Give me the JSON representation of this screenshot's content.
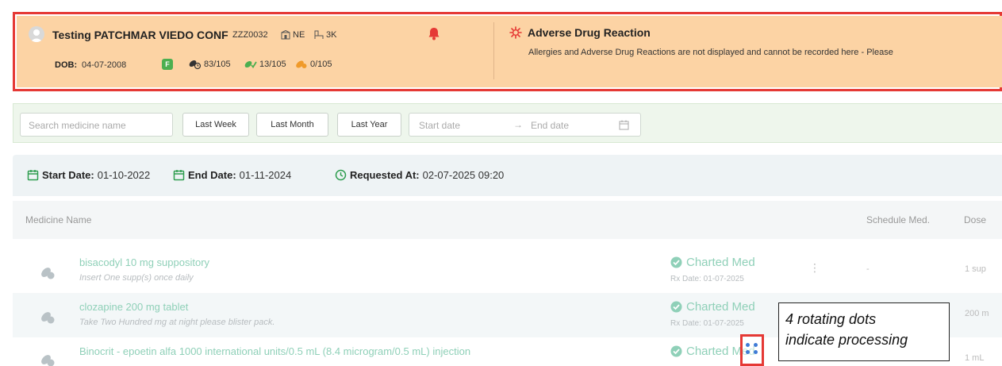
{
  "patient": {
    "name": "Testing PATCHMAR VIEDO CONF",
    "id": "ZZZ0032",
    "ward": "NE",
    "bed": "3K",
    "dob_label": "DOB:",
    "dob": "04-07-2008",
    "gender": "F",
    "stats": [
      "83/105",
      "13/105",
      "0/105"
    ]
  },
  "adr": {
    "title": "Adverse Drug Reaction",
    "text": "Allergies and Adverse Drug Reactions are not displayed and cannot be recorded here - Please"
  },
  "filters": {
    "search_placeholder": "Search medicine name",
    "buttons": [
      "Last Week",
      "Last Month",
      "Last Year"
    ],
    "start_placeholder": "Start date",
    "arrow": "→",
    "end_placeholder": "End date"
  },
  "info": {
    "start_label": "Start Date:",
    "start_value": "01-10-2022",
    "end_label": "End Date:",
    "end_value": "01-11-2024",
    "requested_label": "Requested At:",
    "requested_value": "02-07-2025 09:20"
  },
  "table": {
    "columns": [
      "Medicine Name",
      "Schedule Med.",
      "Dose"
    ],
    "rows": [
      {
        "name": "bisacodyl 10 mg suppository",
        "instruction": "Insert One supp(s) once daily",
        "status": "Charted Med",
        "rx_date": "Rx Date: 01-07-2025",
        "schedule": "-",
        "dose": "1 sup"
      },
      {
        "name": "clozapine 200 mg tablet",
        "instruction": "Take Two Hundred mg at night please blister pack.",
        "status": "Charted Med",
        "rx_date": "Rx Date: 01-07-2025",
        "schedule": "",
        "dose": "200 m"
      },
      {
        "name": "Binocrit - epoetin alfa 1000 international units/0.5 mL (8.4 microgram/0.5 mL) injection",
        "instruction": "",
        "status": "Charted Med",
        "rx_date": "",
        "schedule": "",
        "dose": "1 mL"
      }
    ]
  },
  "callout": {
    "line1": "4 rotating dots",
    "line2": "indicate processing"
  },
  "colors": {
    "banner_bg": "#fcd3a4",
    "highlight": "#e53935",
    "charted": "#8fd0b8",
    "accent_green": "#4caf50",
    "dots": "#3f7bd6"
  }
}
